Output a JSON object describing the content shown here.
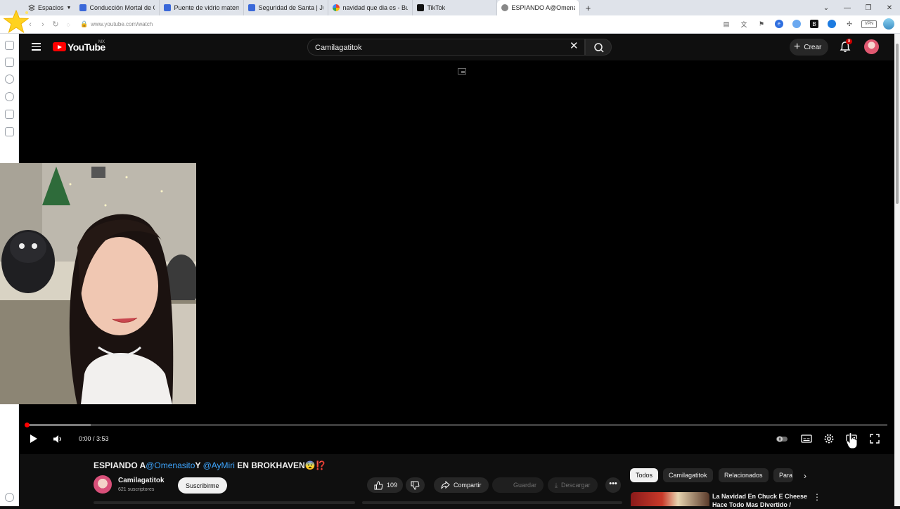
{
  "browser": {
    "spaces_label": "Espacios",
    "tabs": [
      {
        "title": "Conducción Mortal de Car",
        "favicon": "doc-icon"
      },
      {
        "title": "Puente de vidrio matemátic",
        "favicon": "doc-icon"
      },
      {
        "title": "Seguridad de Santa | Juega",
        "favicon": "doc-icon"
      },
      {
        "title": "navidad que dia es - Buscar",
        "favicon": "google-icon"
      },
      {
        "title": "TikTok",
        "favicon": "tiktok-icon"
      },
      {
        "title": "ESPIANDO A@OmenasitoY",
        "favicon": "speaker-icon",
        "active": true
      }
    ],
    "url": "www.youtube.com/watch",
    "vpn_label": "VPN"
  },
  "youtube": {
    "logo_text": "YouTube",
    "country_code": "MX",
    "search_value": "Camilagatitok",
    "create_label": "Crear",
    "notification_count": "8"
  },
  "player": {
    "time": "0:00 / 3:53",
    "played_fraction": 0.0,
    "buffered_fraction": 0.075
  },
  "video": {
    "title_prefix": "ESPIANDO A",
    "mention_1": "@Omenasito",
    "title_mid": "Y ",
    "mention_2": "@AyMiri",
    "title_suffix": " EN BROKHAVEN😨⁉️",
    "channel_name": "Camilagatitok",
    "subscribers": "621 suscriptores",
    "subscribe_label": "Suscribirme",
    "likes": "109",
    "share_label": "Compartir",
    "save_label": "Guardar",
    "download_label": "Descargar"
  },
  "chips": [
    "Todos",
    "Camilagatitok",
    "Relacionados",
    "Para"
  ],
  "recommendation": {
    "title": "La Navidad En Chuck E Cheese Hace Todo Mas Divertido /"
  },
  "colors": {
    "accent": "#ff0000",
    "mention": "#3ea6ff",
    "bg": "#0f0f0f"
  }
}
